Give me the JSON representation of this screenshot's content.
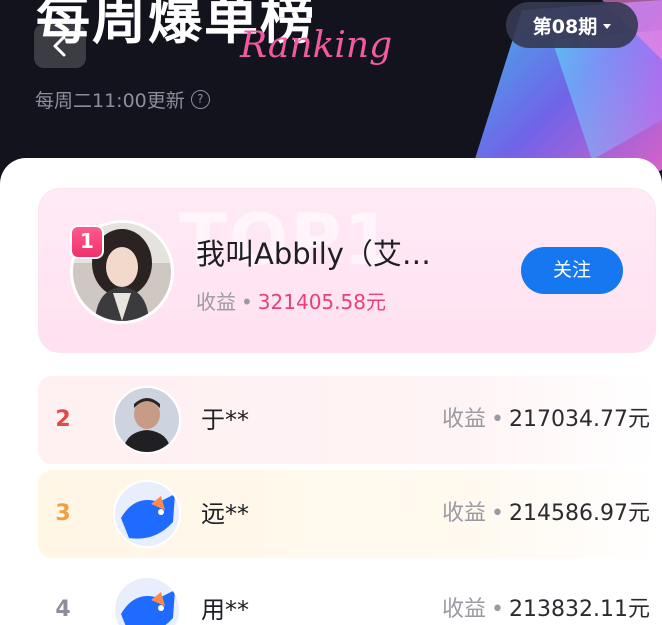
{
  "header": {
    "title": "每周爆单榜",
    "title_en": "Ranking",
    "subtitle": "每周二11:00更新",
    "period": "第08期",
    "icons": [
      "back-icon",
      "help-icon",
      "caret-down-icon"
    ]
  },
  "top1": {
    "rank": "1",
    "name": "我叫Abbily（艾…",
    "earn_label": "收益",
    "earn_value": "321405.58元",
    "follow_label": "关注"
  },
  "rows": [
    {
      "rank": "2",
      "name": "于**",
      "earn_label": "收益",
      "earn_value": "217034.77元"
    },
    {
      "rank": "3",
      "name": "远**",
      "earn_label": "收益",
      "earn_value": "214586.97元"
    },
    {
      "rank": "4",
      "name": "用**",
      "earn_label": "收益",
      "earn_value": "213832.11元"
    }
  ],
  "colors": {
    "accent": "#1578f0",
    "top1_value": "#e9407a",
    "rank2": "#e24a4a",
    "rank3": "#f0a040",
    "rank4": "#8a8f9a"
  }
}
